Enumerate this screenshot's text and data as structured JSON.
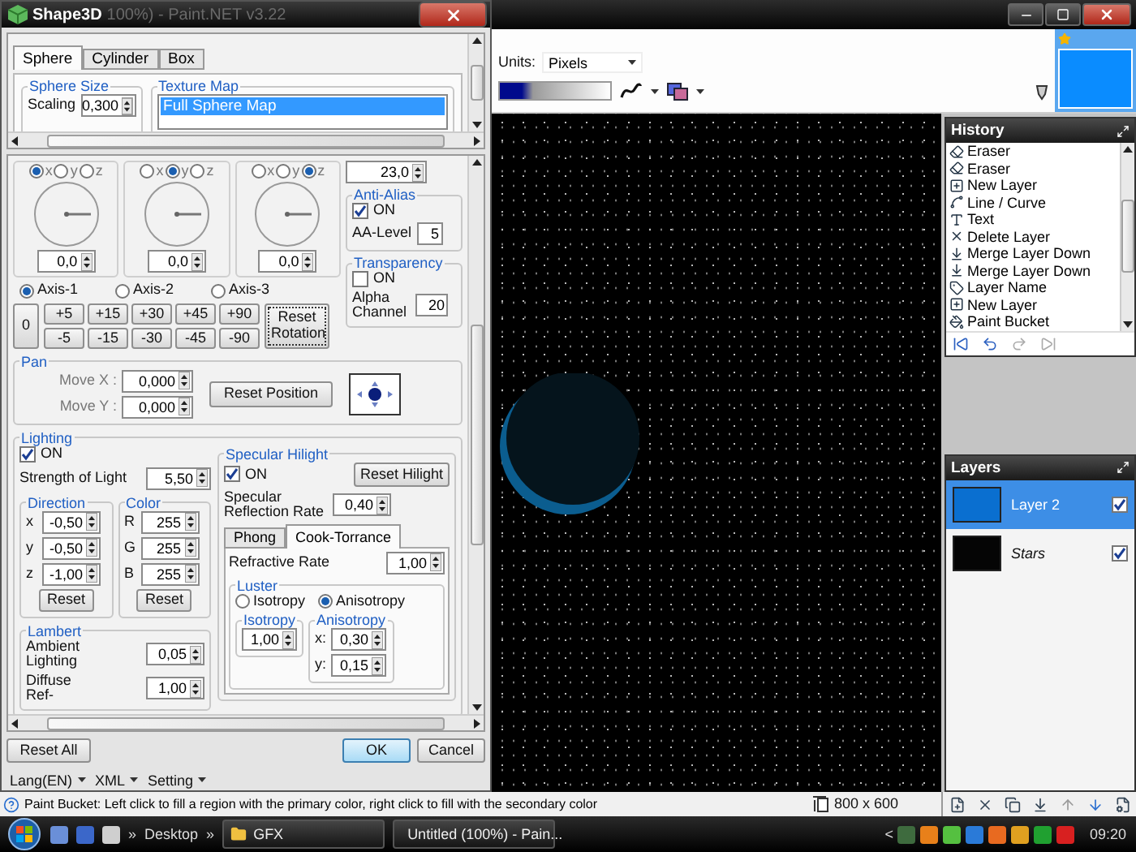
{
  "dialog": {
    "title": "Shape3D",
    "behind_title": "100%) - Paint.NET v3.22",
    "tabs": [
      {
        "label": "Sphere",
        "selected": true
      },
      {
        "label": "Cylinder",
        "selected": false
      },
      {
        "label": "Box",
        "selected": false
      }
    ],
    "sphere_size": {
      "title": "Sphere Size",
      "label": "Scaling",
      "value": "0,300"
    },
    "texture_map": {
      "title": "Texture Map",
      "items": [
        {
          "label": "Full Sphere Map",
          "selected": true
        }
      ]
    },
    "dials": [
      {
        "axes": [
          {
            "label": "x",
            "selected": true
          },
          {
            "label": "y",
            "selected": false
          },
          {
            "label": "z",
            "selected": false
          }
        ],
        "value": "0,0"
      },
      {
        "axes": [
          {
            "label": "x",
            "selected": false
          },
          {
            "label": "y",
            "selected": true
          },
          {
            "label": "z",
            "selected": false
          }
        ],
        "value": "0,0"
      },
      {
        "axes": [
          {
            "label": "x",
            "selected": false
          },
          {
            "label": "y",
            "selected": false
          },
          {
            "label": "z",
            "selected": true
          }
        ],
        "value": "0,0"
      }
    ],
    "side_value": "23,0",
    "anti_alias": {
      "title": "Anti-Alias",
      "on_label": "ON",
      "checked": true,
      "level_label": "AA-Level",
      "level": "5"
    },
    "transparency": {
      "title": "Transparency",
      "on_label": "ON",
      "checked": false,
      "alpha_label": "Alpha Channel",
      "alpha": "20"
    },
    "axes": [
      {
        "label": "Axis-1",
        "selected": true
      },
      {
        "label": "Axis-2",
        "selected": false
      },
      {
        "label": "Axis-3",
        "selected": false
      }
    ],
    "zero_button": "0",
    "plus_buttons": [
      "+5",
      "+15",
      "+30",
      "+45",
      "+90"
    ],
    "minus_buttons": [
      "-5",
      "-15",
      "-30",
      "-45",
      "-90"
    ],
    "reset_rotation": "Reset Rotation",
    "pan": {
      "title": "Pan",
      "fields": [
        {
          "label": "Move X :",
          "value": "0,000"
        },
        {
          "label": "Move Y :",
          "value": "0,000"
        }
      ],
      "reset": "Reset Position"
    },
    "lighting": {
      "title": "Lighting",
      "on_label": "ON",
      "checked": true,
      "strength_label": "Strength of Light",
      "strength": "5,50",
      "direction": {
        "title": "Direction",
        "fields": [
          {
            "label": "x",
            "value": "-0,50"
          },
          {
            "label": "y",
            "value": "-0,50"
          },
          {
            "label": "z",
            "value": "-1,00"
          }
        ],
        "reset": "Reset"
      },
      "color": {
        "title": "Color",
        "fields": [
          {
            "label": "R",
            "value": "255"
          },
          {
            "label": "G",
            "value": "255"
          },
          {
            "label": "B",
            "value": "255"
          }
        ],
        "reset": "Reset"
      },
      "lambert": {
        "title": "Lambert",
        "fields": [
          {
            "label": "Ambient Lighting",
            "value": "0,05"
          },
          {
            "label": "Diffuse Ref-",
            "value": "1,00"
          }
        ]
      }
    },
    "specular": {
      "title": "Specular Hilight",
      "on_label": "ON",
      "checked": true,
      "reset": "Reset Hilight",
      "rate_label": "Specular Reflection Rate",
      "rate": "0,40",
      "tabs": [
        {
          "label": "Phong",
          "selected": false
        },
        {
          "label": "Cook-Torrance",
          "selected": true
        }
      ],
      "refractive_label": "Refractive Rate",
      "refractive": "1,00",
      "luster": {
        "title": "Luster",
        "modes": [
          {
            "label": "Isotropy",
            "selected": false
          },
          {
            "label": "Anisotropy",
            "selected": true
          }
        ],
        "isotropy": {
          "title": "Isotropy",
          "value": "1,00"
        },
        "anisotropy": {
          "title": "Anisotropy",
          "fields": [
            {
              "label": "x:",
              "value": "0,30"
            },
            {
              "label": "y:",
              "value": "0,15"
            }
          ]
        }
      }
    },
    "reset_all": "Reset All",
    "ok": "OK",
    "cancel": "Cancel",
    "footer": [
      "Lang(EN)",
      "XML",
      "Setting"
    ]
  },
  "toolbar": {
    "units_label": "Units:",
    "units": "Pixels"
  },
  "history": {
    "title": "History",
    "items": [
      {
        "label": "Eraser",
        "kind": "eraser"
      },
      {
        "label": "Eraser",
        "kind": "eraser"
      },
      {
        "label": "New Layer",
        "kind": "new-layer"
      },
      {
        "label": "Line / Curve",
        "kind": "line"
      },
      {
        "label": "Text",
        "kind": "text"
      },
      {
        "label": "Delete Layer",
        "kind": "delete"
      },
      {
        "label": "Merge Layer Down",
        "kind": "merge"
      },
      {
        "label": "Merge Layer Down",
        "kind": "merge"
      },
      {
        "label": "Layer Name",
        "kind": "rename"
      },
      {
        "label": "New Layer",
        "kind": "new-layer"
      },
      {
        "label": "Paint Bucket",
        "kind": "bucket"
      }
    ]
  },
  "layers": {
    "title": "Layers",
    "items": [
      {
        "name": "Layer 2",
        "selected": true,
        "visible": true,
        "color": "#0a6fd0"
      },
      {
        "name": "Stars",
        "selected": false,
        "visible": true,
        "color": "#050505"
      }
    ]
  },
  "status_bar": {
    "text": "Paint Bucket: Left click to fill a region with the primary color, right click to fill with the secondary color",
    "size": "800 x 600"
  },
  "taskbar": {
    "chevron_left": "»",
    "toolbar_label": "Desktop",
    "chevron_right": "»",
    "windows": [
      {
        "label": "GFX",
        "kind": "folder"
      },
      {
        "label": "Untitled (100%) - Pain...",
        "kind": "paint"
      }
    ],
    "tray_toggle": "<",
    "clock": "09:20"
  }
}
